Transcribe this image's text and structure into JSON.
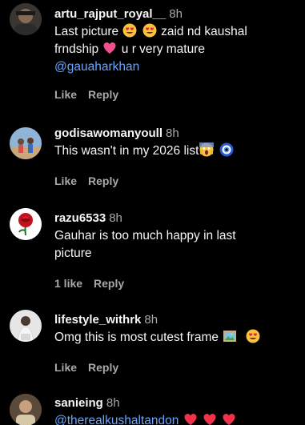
{
  "comments": [
    {
      "username": "artu_rajput_royal__",
      "time": "8h",
      "text_line1": "Last picture",
      "text_line1_b": "zaid nd kaushal",
      "text_line2": "frndship",
      "text_line2_b": "u r very mature",
      "mention": "@gauaharkhan",
      "like": "Like",
      "reply": "Reply"
    },
    {
      "username": "godisawomanyoull",
      "time": "8h",
      "text": "This wasn't in my 2026 list",
      "like": "Like",
      "reply": "Reply"
    },
    {
      "username": "razu6533",
      "time": "8h",
      "text": "Gauhar is too much happy in last picture",
      "likes_count": "1 like",
      "reply": "Reply"
    },
    {
      "username": "lifestyle_withrk",
      "time": "8h",
      "text": "Omg this is most cutest frame",
      "like": "Like",
      "reply": "Reply"
    },
    {
      "username": "sanieing",
      "time": "8h",
      "mention": "@therealkushaltandon"
    }
  ],
  "icons": [
    "smiling-face-with-heart-eyes-icon",
    "pink-heart-icon",
    "face-screaming-icon",
    "nazar-amulet-icon",
    "framed-picture-icon",
    "red-heart-icon"
  ],
  "colors": {
    "background": "#000000",
    "text": "#f5f5f5",
    "muted": "#a8a8a8",
    "mention": "#6aa6ff"
  }
}
